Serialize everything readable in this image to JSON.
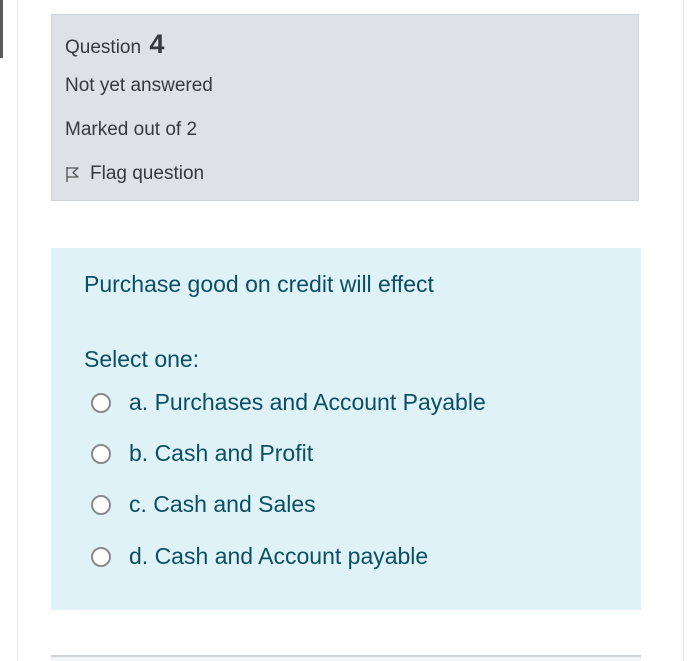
{
  "question_info": {
    "label": "Question",
    "number": "4",
    "state": "Not yet answered",
    "grade": "Marked out of 2",
    "flag_label": "Flag question"
  },
  "question": {
    "text": "Purchase good on credit will effect",
    "prompt": "Select one:",
    "answers": [
      {
        "label": "a. Purchases and Account Payable"
      },
      {
        "label": "b. Cash and Profit"
      },
      {
        "label": "c. Cash and Sales"
      },
      {
        "label": "d. Cash and Account payable"
      }
    ]
  },
  "colors": {
    "info_background": "#dee2e6",
    "content_background": "#def2f8",
    "content_text": "#0a4f63"
  }
}
